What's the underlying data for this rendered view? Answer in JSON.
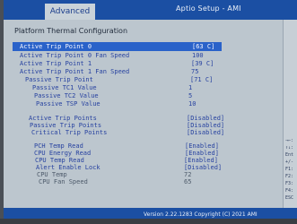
{
  "header": {
    "tab_label": "Advanced",
    "title": "Aptio Setup - AMI"
  },
  "page": {
    "title": "Platform Thermal Configuration"
  },
  "rows": {
    "atp0": {
      "label": "Active Trip Point 0",
      "value": "[63 C]"
    },
    "atp0fan": {
      "label": "Active Trip Point 0 Fan Speed",
      "value": "100"
    },
    "atp1": {
      "label": "Active Trip Point 1",
      "value": "[39 C]"
    },
    "atp1fan": {
      "label": "Active Trip Point 1 Fan Speed",
      "value": "75"
    },
    "ptp": {
      "label": "Passive Trip Point",
      "value": "[71 C]"
    },
    "ptc1": {
      "label": "Passive TC1 Value",
      "value": "1"
    },
    "ptc2": {
      "label": "Passive TC2 Value",
      "value": "5"
    },
    "ptsp": {
      "label": "Passive TSP Value",
      "value": "10"
    },
    "atps": {
      "label": "Active Trip Points",
      "value": "[Disabled]"
    },
    "ptps": {
      "label": "Passive Trip Points",
      "value": "[Disabled]"
    },
    "ctps": {
      "label": "Critical Trip Points",
      "value": "[Disabled]"
    },
    "pch": {
      "label": "PCH Temp Read",
      "value": "[Enabled]"
    },
    "cpuenergy": {
      "label": "CPU Energy Read",
      "value": "[Enabled]"
    },
    "cputempread": {
      "label": "CPU Temp Read",
      "value": "[Enabled]"
    },
    "alert": {
      "label": "Alert Enable Lock",
      "value": "[Disabled]"
    },
    "cputemp": {
      "label": "CPU Temp",
      "value": "72"
    },
    "cpufan": {
      "label": "CPU Fan Speed",
      "value": "65"
    }
  },
  "right_panel": {
    "lines": [
      "→←:",
      "↑↓:",
      "Ent",
      "+/-",
      "F1:",
      "F2:",
      "F3:",
      "F4:",
      "ESC"
    ]
  },
  "footer": {
    "text": "Version 2.22.1283 Copyright (C) 2021 AMI"
  },
  "colors": {
    "banner": "#1b4fa3",
    "panel": "#bcc6ce",
    "highlight": "#2a62c9",
    "value_text": "#2742a0"
  }
}
